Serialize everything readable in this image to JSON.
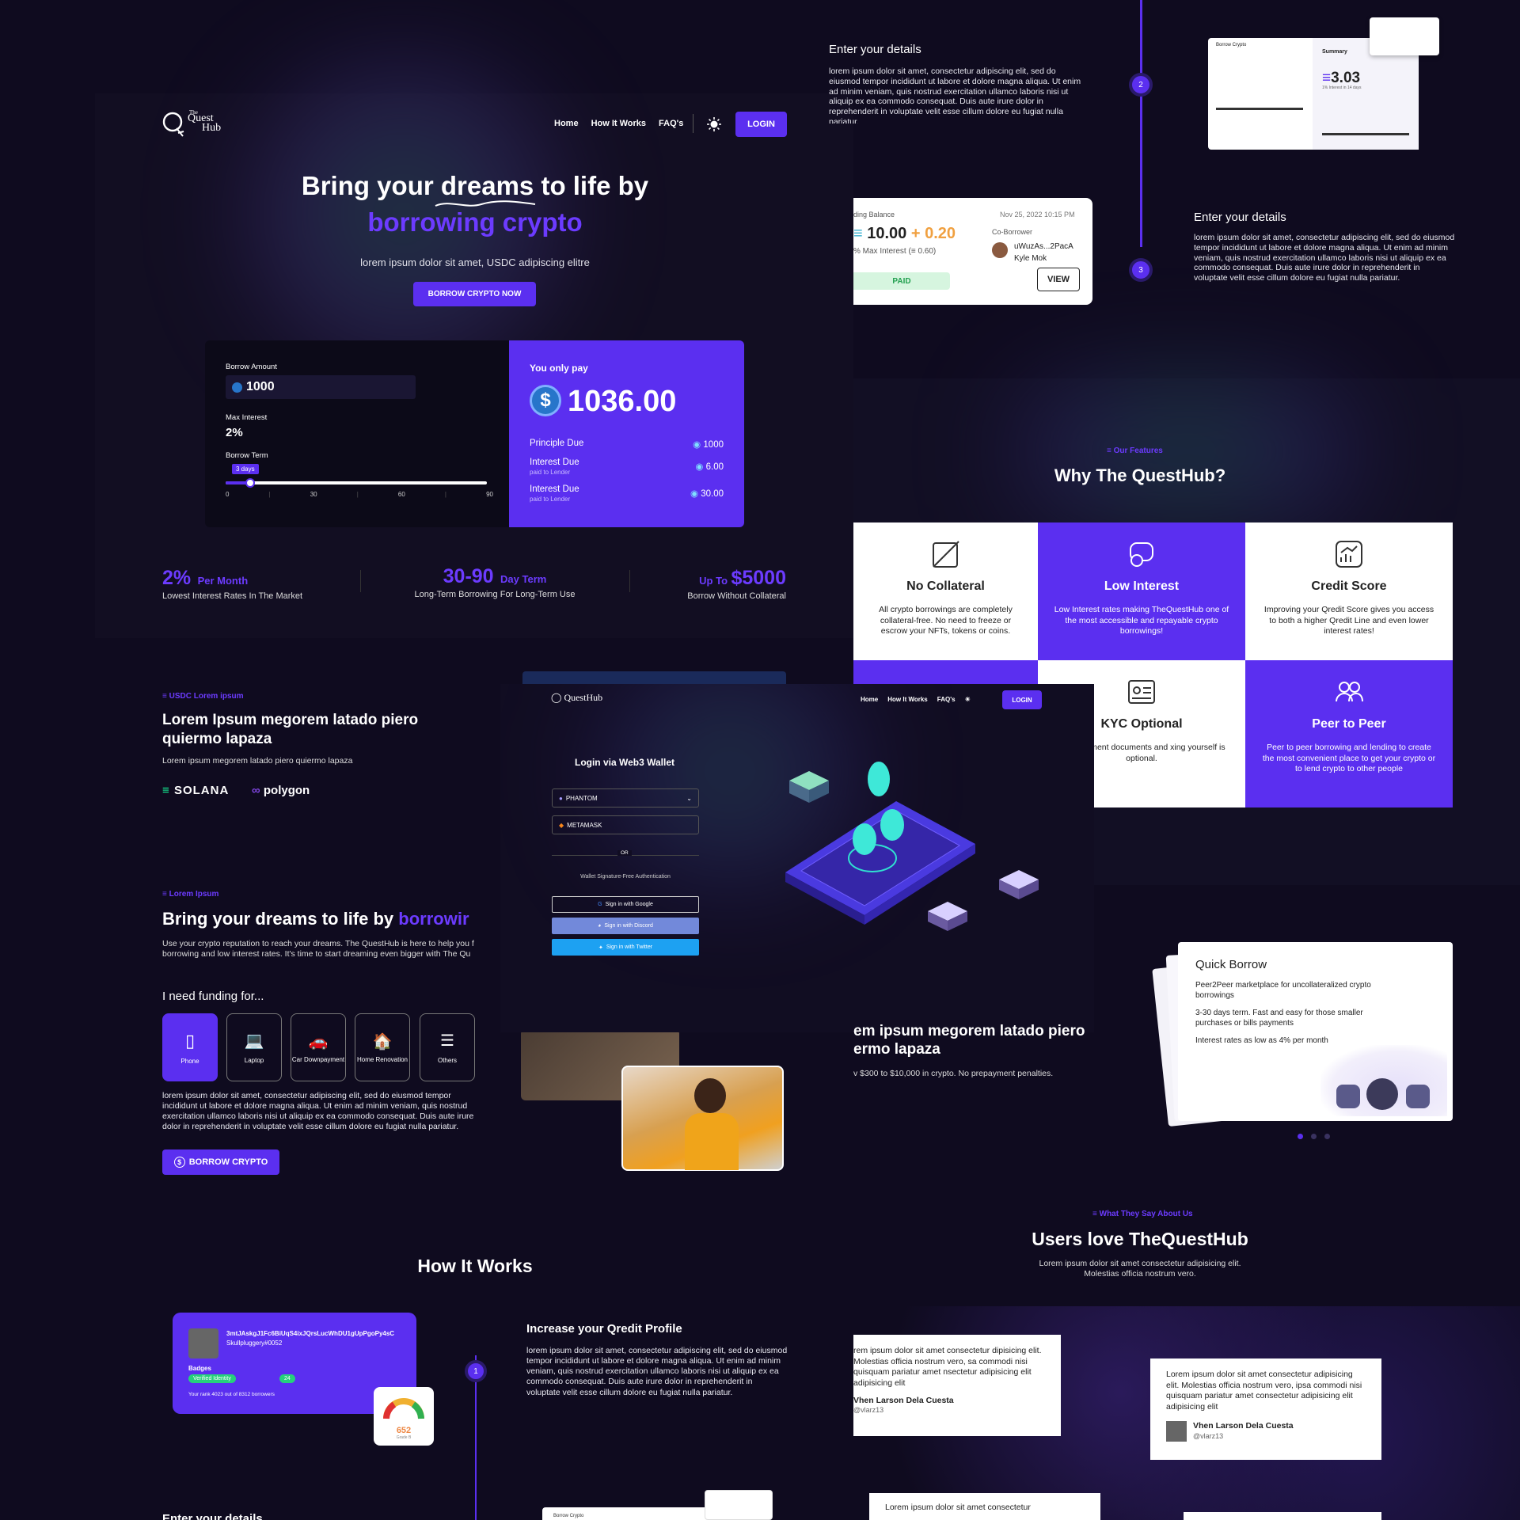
{
  "hero": {
    "brand_top": "The",
    "brand_mid": "Quest",
    "brand_bottom": "Hub",
    "nav": [
      "Home",
      "How It Works",
      "FAQ's"
    ],
    "login": "LOGIN",
    "title_line1a": "Bring your ",
    "title_line1b": "dreams",
    "title_line1c": " to life by",
    "title_line2": "borrowing crypto",
    "subtitle": "lorem ipsum dolor sit amet, USDC adipiscing elitre",
    "cta": "BORROW CRYPTO NOW"
  },
  "calculator": {
    "borrow_amount_label": "Borrow Amount",
    "borrow_amount": "1000",
    "max_interest_label": "Max Interest",
    "max_interest": "2%",
    "borrow_term_label": "Borrow Term",
    "term_value": "3 days",
    "term_fraction": 0.033,
    "ticks": [
      "0",
      "30",
      "60",
      "90"
    ],
    "you_only_pay": "You only pay",
    "total": "1036.00",
    "rows": [
      {
        "label": "Principle Due",
        "sub": "",
        "value": "1000"
      },
      {
        "label": "Interest Due",
        "sub": "paid to Lender",
        "value": "6.00"
      },
      {
        "label": "Interest Due",
        "sub": "paid to Lender",
        "value": "30.00"
      }
    ]
  },
  "stats": [
    {
      "big": "2%",
      "unit": "Per Month",
      "desc": "Lowest Interest Rates In The Market"
    },
    {
      "big": "30-90",
      "unit": "Day Term",
      "desc": "Long-Term Borrowing For Long-Term Use"
    },
    {
      "pre": "Up To",
      "big": "$5000",
      "desc": "Borrow Without Collateral"
    }
  ],
  "usdc": {
    "tag": "USDC Lorem ipsum",
    "title": "Lorem Ipsum megorem latado piero quiermo lapaza",
    "desc": "Lorem ipsum megorem latado piero quiermo lapaza",
    "solana": "SOLANA",
    "polygon": "polygon"
  },
  "dreams": {
    "tag": "Lorem Ipsum",
    "title_a": "Bring your dreams to life by ",
    "title_b": "borrowir",
    "desc": "Use your crypto reputation to reach your dreams. The QuestHub is here to help you f borrowing and low interest rates. It's time to start dreaming even bigger with The Qu",
    "funding_label": "I need funding for...",
    "chips": [
      "Phone",
      "Laptop",
      "Car Downpayment",
      "Home Renovation",
      "Others"
    ],
    "body": "lorem ipsum dolor sit amet, consectetur adipiscing elit, sed do eiusmod tempor incididunt ut labore et dolore magna aliqua. Ut enim ad minim veniam, quis nostrud exercitation ullamco laboris nisi ut aliquip ex ea commodo consequat. Duis aute irure dolor in reprehenderit in voluptate velit esse cillum dolore eu fugiat nulla pariatur.",
    "cta": "BORROW CRYPTO"
  },
  "how": {
    "title": "How It Works",
    "profile_addr": "3mtJAskgJ1Fc6BiUqS4ixJQrsLucWhDU1gUpPgoPy4sC",
    "profile_name": "Skullpluggery#0052",
    "badges_label": "Badges",
    "verified": "Verified Identity",
    "badge_count": "24",
    "rank_text": "Your rank 4023 out of 8312 borrowers",
    "score": "652",
    "score_grade": "Grade B",
    "step1_num": "1",
    "step1_title": "Increase your Qredit Profile",
    "step1_body": "lorem ipsum dolor sit amet, consectetur adipiscing elit, sed do eiusmod tempor incididunt ut labore et dolore magna aliqua. Ut enim ad minim veniam, quis nostrud exercitation ullamco laboris nisi ut aliquip ex ea commodo consequat. Duis aute irure dolor in reprehenderit in voluptate velit esse cillum dolore eu fugiat nulla pariatur.",
    "bottom_title": "Enter your details",
    "bottom_mini": "Borrow Crypto"
  },
  "steps_right": {
    "s2_title": "Enter your details",
    "s2_body": "lorem ipsum dolor sit amet, consectetur adipiscing elit, sed do eiusmod tempor incididunt ut labore et dolore magna aliqua. Ut enim ad minim veniam, quis nostrud exercitation ullamco laboris nisi ut aliquip ex ea commodo consequat. Duis aute irure dolor in reprehenderit in voluptate velit esse cillum dolore eu fugiat nulla pariatur.",
    "s2_num": "2",
    "s3_num": "3",
    "s3_title": "Enter your details",
    "s3_body": "lorem ipsum dolor sit amet, consectetur adipiscing elit, sed do eiusmod tempor incididunt ut labore et dolore magna aliqua. Ut enim ad minim veniam, quis nostrud exercitation ullamco laboris nisi ut aliquip ex ea commodo consequat. Duis aute irure dolor in reprehenderit in voluptate velit esse cillum dolore eu fugiat nulla pariatur.",
    "summary_label": "Summary",
    "summary_value": "3.03",
    "summary_sub": "1% Interest in 14 days",
    "mini_title": "Borrow Crypto",
    "balance_label": "ding Balance",
    "balance_date": "Nov 25, 2022 10:15 PM",
    "balance_a": "10.00",
    "balance_b": "+ 0.20",
    "balance_sub": "% Max Interest (",
    "balance_sub2": "0.60)",
    "coborrower": "Co-Borrower",
    "co_addr": "uWuzAs...2PacA",
    "co_name": "Kyle Mok",
    "paid": "PAID",
    "view": "VIEW"
  },
  "features": {
    "tag": "Our Features",
    "title": "Why The QuestHub?",
    "items": [
      {
        "title": "No Collateral",
        "desc": "All crypto borrowings are completely collateral-free. No need to freeze or escrow your NFTs, tokens or coins."
      },
      {
        "title": "Low Interest",
        "desc": "Low Interest rates making TheQuestHub one of the most accessible and repayable crypto borrowings!"
      },
      {
        "title": "Credit Score",
        "desc": "Improving your Qredit Score gives you access to both a higher Qredit Line and even lower interest rates!"
      },
      {
        "title": "KYC Optional",
        "desc": "g government documents and xing yourself is optional."
      },
      {
        "title": "Peer to Peer",
        "desc": "Peer to peer borrowing and lending to create the most convenient place to get your crypto or to lend crypto to other people"
      }
    ]
  },
  "login_modal": {
    "nav": [
      "Home",
      "How It Works",
      "FAQ's"
    ],
    "login": "LOGIN",
    "title": "Login via Web3 Wallet",
    "phantom": "PHANTOM",
    "metamask": "METAMASK",
    "or": "OR",
    "sig": "Wallet Signature-Free Authentication",
    "google": "Sign in with Google",
    "discord": "Sign in with Discord",
    "twitter": "Sign in with Twitter"
  },
  "middle": {
    "title": "em ipsum megorem latado piero ermo lapaza",
    "desc": "v $300 to $10,000 in crypto. No prepayment penalties."
  },
  "quick": {
    "title": "Quick Borrow",
    "lines": [
      "Peer2Peer marketplace for uncollateralized crypto borrowings",
      "3-30 days term. Fast and easy for those smaller purchases or bills payments",
      "Interest rates as low as 4% per month"
    ]
  },
  "testimonials": {
    "tag": "What They Say About Us",
    "title": "Users love TheQuestHub",
    "desc": "Lorem ipsum dolor sit amet consectetur adipisicing elit. Molestias officia nostrum vero.",
    "items": [
      {
        "text": "rem ipsum dolor sit amet consectetur dipisicing elit. Molestias officia nostrum vero, sa commodi nisi quisquam pariatur amet nsectetur adipisicing elit adipisicing elit",
        "name": "Vhen Larson Dela Cuesta",
        "handle": "@vlarz13"
      },
      {
        "text": "Lorem ipsum dolor sit amet consectetur adipisicing elit. Molestias officia nostrum vero, ipsa commodi nisi quisquam pariatur amet consectetur adipisicing elit adipisicing elit",
        "name": "Vhen Larson Dela Cuesta",
        "handle": "@vlarz13"
      },
      {
        "text": "Lorem ipsum dolor sit amet consectetur",
        "name": "",
        "handle": ""
      }
    ]
  },
  "colors": {
    "accent": "#5b2ff0",
    "bg": "#0f0b1f",
    "usdc": "#2775ca"
  }
}
